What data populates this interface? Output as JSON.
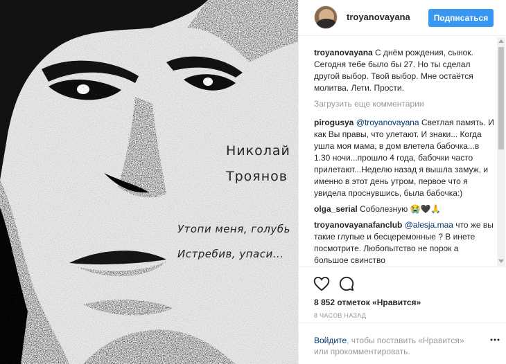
{
  "photo": {
    "name_line1": "Николай",
    "name_line2": "Троянов",
    "poem_line1": "Утопи меня, голубь",
    "poem_line2": "Истребив, упаси..."
  },
  "header": {
    "username": "troyanovayana",
    "follow_label": "Подписаться"
  },
  "caption": {
    "user": "troyanovayana",
    "text": "С днём рождения, сынок. Сегодня тебе было бы 27. Но ты сделал другой выбор. Твой выбор. Мне остаётся молитва. Лети. Прости."
  },
  "load_more": "Загрузить еще комментарии",
  "comments": [
    {
      "user": "pirogusya",
      "mention": "@troyanovayana",
      "text": " Светлая память. И как Вы правы, что улетают. И знаки... Когда ушла моя мама, в дом влетела бабочка...в 1.30 ночи...прошло 4 года, бабочки часто прилетают...Неделю назад я вышла замуж, и именно в этот день утром, первое что я увидела проснувшись, была бабочка:)"
    },
    {
      "user": "olga_serial",
      "mention": "",
      "text": " Соболезную 😭🖤🙏"
    },
    {
      "user": "troyanovayanafanclub",
      "mention": "@alesja.maa",
      "text": " что же вы такие глупые и бесцеремонные ? В инете посмотрите. Любопытство не порок а большое свинство"
    }
  ],
  "actions": {
    "likes": "8 852 отметок «Нравится»",
    "timestamp": "8 ЧАСОВ НАЗАД"
  },
  "login": {
    "link": "Войдите",
    "text": ", чтобы поставить «Нравится» или прокомментировать."
  },
  "colors": {
    "accent": "#3897f0",
    "link": "#003569",
    "muted": "#999999"
  },
  "icons": [
    "heart-icon",
    "comment-icon",
    "more-dots-icon"
  ]
}
